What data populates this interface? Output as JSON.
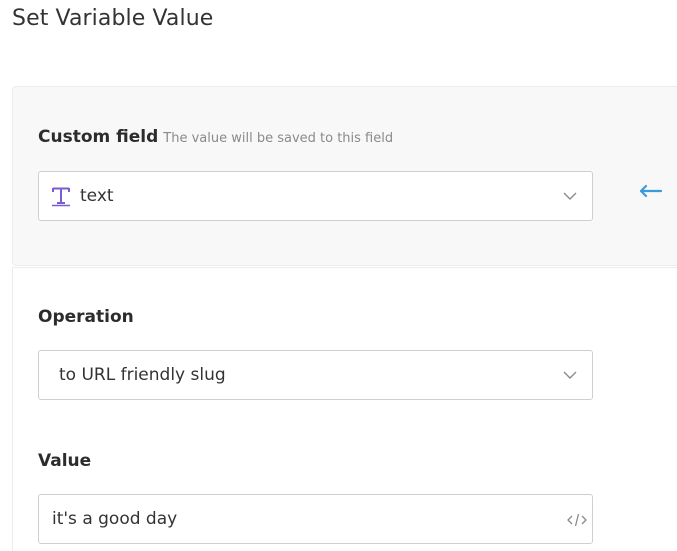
{
  "header": {
    "title": "Set Variable Value"
  },
  "custom_field": {
    "label": "Custom field",
    "hint": "The value will be saved to this field",
    "selected": "text",
    "type_icon": "text-type-icon",
    "accent_color": "#7b5cd6"
  },
  "link_arrow": {
    "icon": "arrow-left-icon",
    "color": "#3d9ad9"
  },
  "operation": {
    "label": "Operation",
    "selected": "to URL friendly slug"
  },
  "value": {
    "label": "Value",
    "input_value": "it's a good day",
    "code_icon": "code-icon"
  }
}
